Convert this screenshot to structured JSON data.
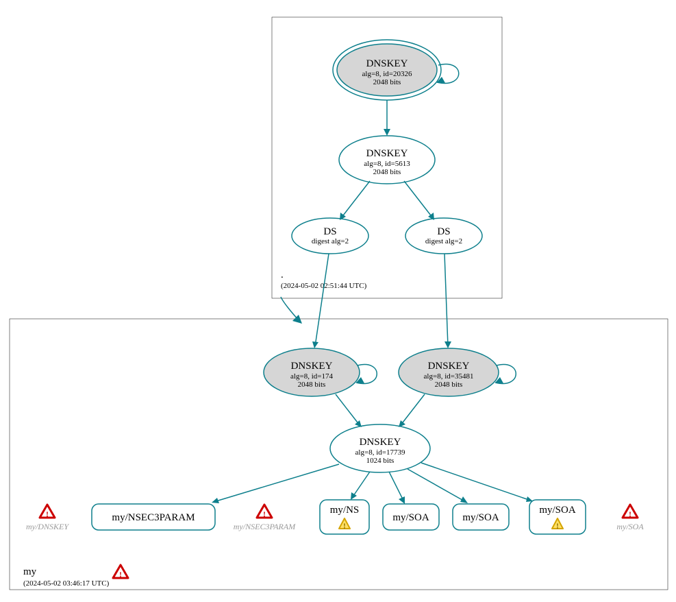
{
  "zones": {
    "root": {
      "label": ".",
      "timestamp": "(2024-05-02 02:51:44 UTC)"
    },
    "my": {
      "label": "my",
      "timestamp": "(2024-05-02 03:46:17 UTC)"
    }
  },
  "nodes": {
    "root_ksk": {
      "title": "DNSKEY",
      "line2": "alg=8, id=20326",
      "line3": "2048 bits"
    },
    "root_zsk": {
      "title": "DNSKEY",
      "line2": "alg=8, id=5613",
      "line3": "2048 bits"
    },
    "root_ds1": {
      "title": "DS",
      "line2": "digest alg=2"
    },
    "root_ds2": {
      "title": "DS",
      "line2": "digest alg=2"
    },
    "my_ksk1": {
      "title": "DNSKEY",
      "line2": "alg=8, id=174",
      "line3": "2048 bits"
    },
    "my_ksk2": {
      "title": "DNSKEY",
      "line2": "alg=8, id=35481",
      "line3": "2048 bits"
    },
    "my_zsk": {
      "title": "DNSKEY",
      "line2": "alg=8, id=17739",
      "line3": "1024 bits"
    },
    "rr_nsec3p": {
      "title": "my/NSEC3PARAM"
    },
    "rr_ns": {
      "title": "my/NS"
    },
    "rr_soa1": {
      "title": "my/SOA"
    },
    "rr_soa2": {
      "title": "my/SOA"
    },
    "rr_soa3": {
      "title": "my/SOA"
    }
  },
  "warnings": {
    "w_dnskey": "my/DNSKEY",
    "w_nsec3p": "my/NSEC3PARAM",
    "w_soa": "my/SOA"
  }
}
